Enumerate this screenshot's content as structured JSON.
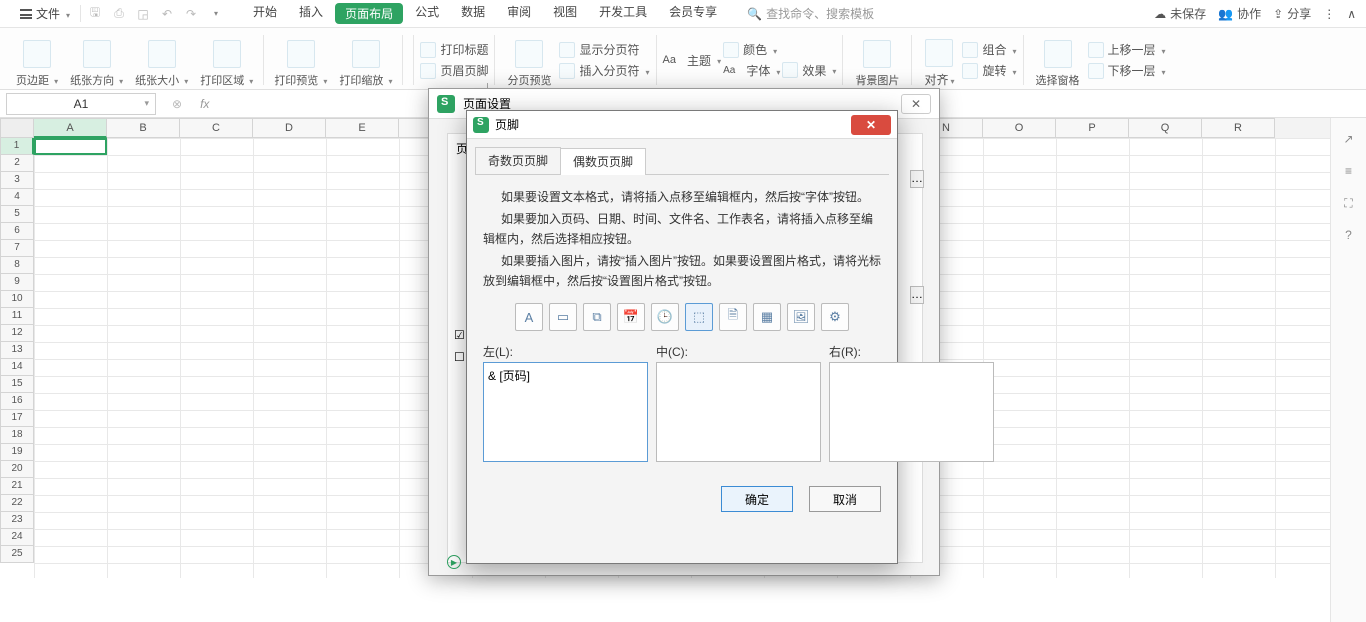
{
  "topbar": {
    "file": "文件",
    "tabs": [
      "开始",
      "插入",
      "页面布局",
      "公式",
      "数据",
      "审阅",
      "视图",
      "开发工具",
      "会员专享"
    ],
    "active_tab_index": 2,
    "search_placeholder": "查找命令、搜索模板",
    "unsaved": "未保存",
    "collab": "协作",
    "share": "分享"
  },
  "ribbon": {
    "groups_large": [
      "页边距",
      "纸张方向",
      "纸张大小",
      "打印区域",
      "打印预览",
      "打印缩放"
    ],
    "stack1": [
      {
        "label": "打印标题"
      },
      {
        "label": "页眉页脚"
      }
    ],
    "group_split": "分页预览",
    "stack2": [
      {
        "label": "显示分页符"
      },
      {
        "label": "插入分页符"
      }
    ],
    "stack3": [
      {
        "label": "主题"
      },
      {
        "label": "颜色"
      },
      {
        "label": "字体"
      },
      {
        "label": "效果"
      }
    ],
    "bg_image": "背景图片",
    "align": "对齐",
    "stack4": [
      {
        "label": "组合"
      },
      {
        "label": "旋转"
      }
    ],
    "select_pane": "选择窗格",
    "stack5": [
      {
        "label": "上移一层"
      },
      {
        "label": "下移一层"
      }
    ]
  },
  "namebox": "A1",
  "columns": [
    "A",
    "B",
    "C",
    "D",
    "E",
    "",
    "",
    "",
    "",
    "",
    "",
    "",
    "N",
    "O",
    "P",
    "Q",
    "R"
  ],
  "rows_count": 25,
  "outer_dialog": {
    "title": "页面设置",
    "side_label": "页"
  },
  "inner_dialog": {
    "title": "页脚",
    "tabs": [
      "奇数页页脚",
      "偶数页页脚"
    ],
    "active_tab": 1,
    "instructions": [
      "如果要设置文本格式，请将插入点移至编辑框内，然后按“字体”按钮。",
      "如果要加入页码、日期、时间、文件名、工作表名，请将插入点移至编辑框内，然后选择相应按钮。",
      "如果要插入图片，请按“插入图片”按钮。如果要设置图片格式，请将光标放到编辑框中，然后按“设置图片格式”按钮。"
    ],
    "tool_icons": [
      "A",
      "▭",
      "⧉",
      "📅",
      "🕒",
      "⬚",
      "🗎",
      "▦",
      "🖼",
      "⚙"
    ],
    "selected_tool": 5,
    "labels": {
      "left": "左(L):",
      "center": "中(C):",
      "right": "右(R):"
    },
    "left_value": "& [页码]",
    "center_value": "",
    "right_value": "",
    "ok": "确定",
    "cancel": "取消"
  },
  "right_panel_icons": [
    "↗",
    "≡",
    "⛶",
    "?"
  ]
}
